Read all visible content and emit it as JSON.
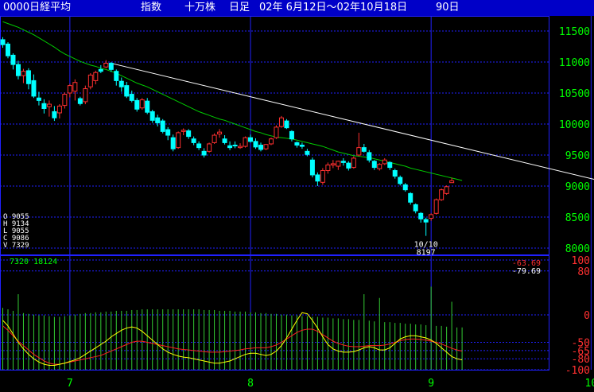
{
  "header": {
    "symbol": "0000日経平均",
    "kind": "指数",
    "unit": "十万株",
    "period": "日足",
    "range": "02年 6月12日～02年10月18日",
    "count": "90日"
  },
  "ohlc_panel": {
    "open": "O 9055",
    "high": "H 9134",
    "low": "L 9055",
    "close": "C 9086",
    "volume": "V 7329"
  },
  "volume_readout": "7320 18124",
  "annotation": {
    "date": "10/10",
    "value": "8197"
  },
  "osc_readouts": [
    "-63.69",
    "-79.69"
  ],
  "colors": {
    "up": "#ff3030",
    "down": "#00ffff",
    "ma": "#00cc00",
    "grid": "#2020ff",
    "axis_text": "#00ff00",
    "trend": "#ffffff",
    "osc1": "#ffff00",
    "osc2": "#ff2020"
  },
  "chart_data": {
    "type": "candlestick",
    "price_axis": {
      "ticks": [
        8000,
        8500,
        9000,
        9500,
        10000,
        10500,
        11000,
        11500
      ],
      "ylim": [
        7950,
        11750
      ]
    },
    "month_labels": [
      "7",
      "8",
      "9",
      "10"
    ],
    "month_index": [
      13,
      48,
      83,
      114
    ],
    "candles": [
      [
        11360,
        11400,
        11230,
        11280
      ],
      [
        11290,
        11320,
        11060,
        11100
      ],
      [
        11110,
        11140,
        10880,
        10960
      ],
      [
        10960,
        11020,
        10720,
        10780
      ],
      [
        10780,
        10890,
        10660,
        10850
      ],
      [
        10860,
        10900,
        10560,
        10650
      ],
      [
        10700,
        10800,
        10420,
        10450
      ],
      [
        10420,
        10520,
        10300,
        10380
      ],
      [
        10330,
        10400,
        10170,
        10250
      ],
      [
        10280,
        10380,
        10120,
        10320
      ],
      [
        10200,
        10290,
        10050,
        10100
      ],
      [
        10180,
        10320,
        10090,
        10290
      ],
      [
        10300,
        10510,
        10250,
        10480
      ],
      [
        10500,
        10650,
        10430,
        10620
      ],
      [
        10530,
        10720,
        10380,
        10670
      ],
      [
        10410,
        10440,
        10300,
        10330
      ],
      [
        10360,
        10620,
        10320,
        10570
      ],
      [
        10600,
        10820,
        10560,
        10790
      ],
      [
        10700,
        10860,
        10640,
        10830
      ],
      [
        10880,
        10950,
        10820,
        10850
      ],
      [
        10920,
        11030,
        10900,
        10980
      ],
      [
        10980,
        11000,
        10840,
        10880
      ],
      [
        10850,
        10880,
        10620,
        10700
      ],
      [
        10690,
        10750,
        10520,
        10600
      ],
      [
        10620,
        10680,
        10420,
        10450
      ],
      [
        10480,
        10540,
        10350,
        10380
      ],
      [
        10380,
        10420,
        10200,
        10240
      ],
      [
        10260,
        10420,
        10230,
        10390
      ],
      [
        10370,
        10420,
        10160,
        10190
      ],
      [
        10200,
        10230,
        10020,
        10060
      ],
      [
        10100,
        10150,
        9960,
        10020
      ],
      [
        10050,
        10080,
        9850,
        9880
      ],
      [
        9910,
        9950,
        9740,
        9820
      ],
      [
        9780,
        9830,
        9560,
        9600
      ],
      [
        9620,
        9880,
        9600,
        9860
      ],
      [
        9880,
        9930,
        9820,
        9900
      ],
      [
        9890,
        9920,
        9760,
        9800
      ],
      [
        9760,
        9800,
        9660,
        9700
      ],
      [
        9680,
        9720,
        9580,
        9620
      ],
      [
        9560,
        9610,
        9460,
        9500
      ],
      [
        9560,
        9700,
        9540,
        9680
      ],
      [
        9700,
        9850,
        9680,
        9820
      ],
      [
        9840,
        9920,
        9780,
        9870
      ],
      [
        9760,
        9820,
        9670,
        9700
      ],
      [
        9650,
        9720,
        9580,
        9620
      ],
      [
        9660,
        9720,
        9610,
        9650
      ],
      [
        9620,
        9690,
        9600,
        9640
      ],
      [
        9640,
        9800,
        9620,
        9780
      ],
      [
        9780,
        9830,
        9700,
        9720
      ],
      [
        9720,
        9770,
        9600,
        9630
      ],
      [
        9660,
        9700,
        9560,
        9590
      ],
      [
        9600,
        9680,
        9580,
        9670
      ],
      [
        9680,
        9780,
        9660,
        9760
      ],
      [
        9780,
        9980,
        9760,
        9950
      ],
      [
        9960,
        10130,
        9940,
        10100
      ],
      [
        10050,
        10080,
        9920,
        9940
      ],
      [
        9880,
        9900,
        9720,
        9760
      ],
      [
        9700,
        9720,
        9620,
        9660
      ],
      [
        9660,
        9700,
        9600,
        9640
      ],
      [
        9560,
        9600,
        9480,
        9510
      ],
      [
        9420,
        9460,
        9140,
        9180
      ],
      [
        9180,
        9220,
        9000,
        9080
      ],
      [
        9060,
        9290,
        9020,
        9250
      ],
      [
        9250,
        9380,
        9200,
        9340
      ],
      [
        9340,
        9420,
        9290,
        9360
      ],
      [
        9320,
        9410,
        9260,
        9400
      ],
      [
        9400,
        9450,
        9330,
        9380
      ],
      [
        9370,
        9400,
        9250,
        9290
      ],
      [
        9300,
        9480,
        9280,
        9450
      ],
      [
        9500,
        9860,
        9480,
        9620
      ],
      [
        9620,
        9680,
        9540,
        9560
      ],
      [
        9540,
        9580,
        9380,
        9420
      ],
      [
        9400,
        9420,
        9260,
        9300
      ],
      [
        9280,
        9370,
        9250,
        9350
      ],
      [
        9360,
        9450,
        9340,
        9420
      ],
      [
        9380,
        9400,
        9260,
        9300
      ],
      [
        9250,
        9280,
        9120,
        9160
      ],
      [
        9140,
        9170,
        9010,
        9040
      ],
      [
        9020,
        9050,
        8910,
        8940
      ],
      [
        8880,
        8900,
        8700,
        8740
      ],
      [
        8700,
        8720,
        8560,
        8600
      ],
      [
        8560,
        8580,
        8410,
        8470
      ],
      [
        8460,
        8490,
        8197,
        8420
      ],
      [
        8480,
        8560,
        8440,
        8540
      ],
      [
        8560,
        8800,
        8540,
        8780
      ],
      [
        8780,
        8960,
        8760,
        8940
      ],
      [
        8880,
        9010,
        8860,
        8990
      ],
      [
        9055,
        9134,
        9055,
        9086
      ]
    ],
    "ma": [
      11650,
      11620,
      11590,
      11560,
      11520,
      11480,
      11440,
      11390,
      11340,
      11290,
      11240,
      11180,
      11130,
      11090,
      11050,
      11010,
      10980,
      10950,
      10930,
      10900,
      10880,
      10850,
      10820,
      10780,
      10740,
      10700,
      10660,
      10630,
      10600,
      10560,
      10520,
      10480,
      10440,
      10400,
      10360,
      10320,
      10280,
      10240,
      10200,
      10170,
      10140,
      10110,
      10080,
      10060,
      10030,
      10000,
      9970,
      9940,
      9910,
      9880,
      9860,
      9830,
      9810,
      9790,
      9780,
      9770,
      9760,
      9740,
      9720,
      9700,
      9680,
      9660,
      9640,
      9610,
      9580,
      9550,
      9530,
      9510,
      9490,
      9480,
      9470,
      9460,
      9440,
      9420,
      9400,
      9380,
      9360,
      9340,
      9320,
      9290,
      9270,
      9250,
      9230,
      9210,
      9190,
      9170,
      9150,
      9130,
      9110,
      9090
    ],
    "trendline": {
      "from": [
        21,
        10980
      ],
      "to": [
        125,
        8900
      ]
    },
    "volume": [
      82,
      80,
      78,
      76,
      75,
      74,
      73,
      72,
      72,
      71,
      70,
      70,
      71,
      72,
      73,
      74,
      75,
      75,
      76,
      76,
      77,
      77,
      78,
      78,
      78,
      79,
      79,
      80,
      80,
      80,
      80,
      80,
      80,
      80,
      80,
      80,
      80,
      80,
      80,
      79,
      79,
      79,
      78,
      78,
      78,
      77,
      77,
      77,
      76,
      76,
      75,
      75,
      74,
      74,
      73,
      73,
      72,
      72,
      71,
      71,
      70,
      70,
      69,
      69,
      68,
      68,
      67,
      67,
      66,
      66,
      65,
      65,
      64,
      64,
      63,
      63,
      62,
      62,
      61,
      61,
      60,
      60,
      59,
      59,
      58,
      58,
      57,
      57,
      56,
      56
    ],
    "volume_spikes": {
      "3": 100,
      "70": 100,
      "73": 95,
      "83": 110,
      "87": 90
    },
    "osc_axis": {
      "ticks": [
        100,
        80,
        0,
        -50,
        -65,
        -80,
        -100
      ],
      "ylim": [
        -100,
        100
      ]
    },
    "osc1": [
      -10,
      -20,
      -35,
      -50,
      -62,
      -72,
      -80,
      -86,
      -90,
      -92,
      -92,
      -90,
      -88,
      -85,
      -82,
      -78,
      -72,
      -66,
      -60,
      -54,
      -48,
      -40,
      -34,
      -28,
      -24,
      -22,
      -24,
      -30,
      -38,
      -46,
      -54,
      -62,
      -68,
      -72,
      -75,
      -77,
      -78,
      -80,
      -82,
      -84,
      -86,
      -88,
      -88,
      -86,
      -84,
      -80,
      -76,
      -72,
      -70,
      -70,
      -72,
      -74,
      -72,
      -66,
      -56,
      -42,
      -26,
      -10,
      4,
      2,
      -10,
      -24,
      -40,
      -54,
      -62,
      -66,
      -68,
      -68,
      -67,
      -64,
      -60,
      -58,
      -60,
      -64,
      -64,
      -60,
      -52,
      -44,
      -40,
      -38,
      -38,
      -40,
      -42,
      -46,
      -52,
      -60,
      -68,
      -76,
      -80,
      -82
    ],
    "osc2": [
      -20,
      -28,
      -38,
      -48,
      -56,
      -64,
      -72,
      -78,
      -84,
      -88,
      -90,
      -90,
      -88,
      -86,
      -84,
      -82,
      -80,
      -78,
      -76,
      -74,
      -70,
      -66,
      -62,
      -58,
      -54,
      -50,
      -48,
      -48,
      -50,
      -52,
      -54,
      -56,
      -58,
      -60,
      -62,
      -63,
      -64,
      -65,
      -66,
      -67,
      -68,
      -68,
      -68,
      -67,
      -66,
      -65,
      -64,
      -62,
      -61,
      -60,
      -60,
      -60,
      -58,
      -55,
      -50,
      -44,
      -38,
      -32,
      -28,
      -26,
      -26,
      -30,
      -36,
      -42,
      -48,
      -52,
      -55,
      -57,
      -58,
      -58,
      -57,
      -56,
      -56,
      -56,
      -55,
      -53,
      -50,
      -47,
      -45,
      -44,
      -44,
      -45,
      -46,
      -48,
      -50,
      -53,
      -57,
      -61,
      -64,
      -66
    ]
  }
}
